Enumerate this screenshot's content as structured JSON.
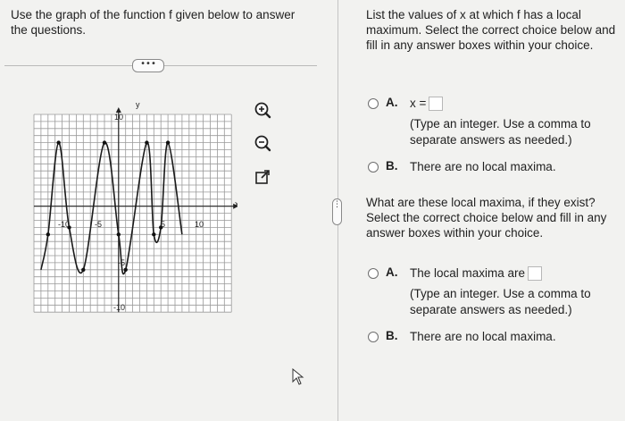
{
  "left": {
    "question": "Use the graph of the function f given below to answer the questions.",
    "more_label": "•••",
    "graph": {
      "x_axis_label": "x",
      "y_axis_label": "y",
      "tick_labels": {
        "x_neg10": "-10",
        "x_neg5": "-5",
        "x_5": "5",
        "x_10": "10",
        "y_10": "10",
        "y_neg5": "-5",
        "y_neg10": "-10"
      },
      "curve_points": [
        [
          -11,
          -9
        ],
        [
          -10,
          -4
        ],
        [
          -8.5,
          9
        ],
        [
          -7,
          -3
        ],
        [
          -5,
          -9
        ],
        [
          -2,
          9
        ],
        [
          0,
          -4
        ],
        [
          1,
          -9
        ],
        [
          4,
          9
        ],
        [
          5,
          -4
        ],
        [
          6,
          -3
        ],
        [
          7,
          9
        ],
        [
          9,
          -4
        ]
      ]
    },
    "tools": [
      "zoom-in-icon",
      "zoom-out-icon",
      "external-link-icon"
    ]
  },
  "divider_handle": "⋮",
  "right": {
    "prompt1": "List the values of x at which f has a local maximum. Select the correct choice below and fill in any answer boxes within your choice.",
    "q1_optA_letter": "A.",
    "q1_optA_prefix": "x =",
    "q1_optA_hint": "(Type an integer. Use a comma to separate answers as needed.)",
    "q1_optB_letter": "B.",
    "q1_optB_text": "There are no local maxima.",
    "prompt2": "What are these local maxima, if they exist? Select the correct choice below and fill in any answer boxes within your choice.",
    "q2_optA_letter": "A.",
    "q2_optA_text": "The local maxima are",
    "q2_optA_hint": "(Type an integer. Use a comma to separate answers as needed.)",
    "q2_optB_letter": "B.",
    "q2_optB_text": "There are no local maxima."
  }
}
